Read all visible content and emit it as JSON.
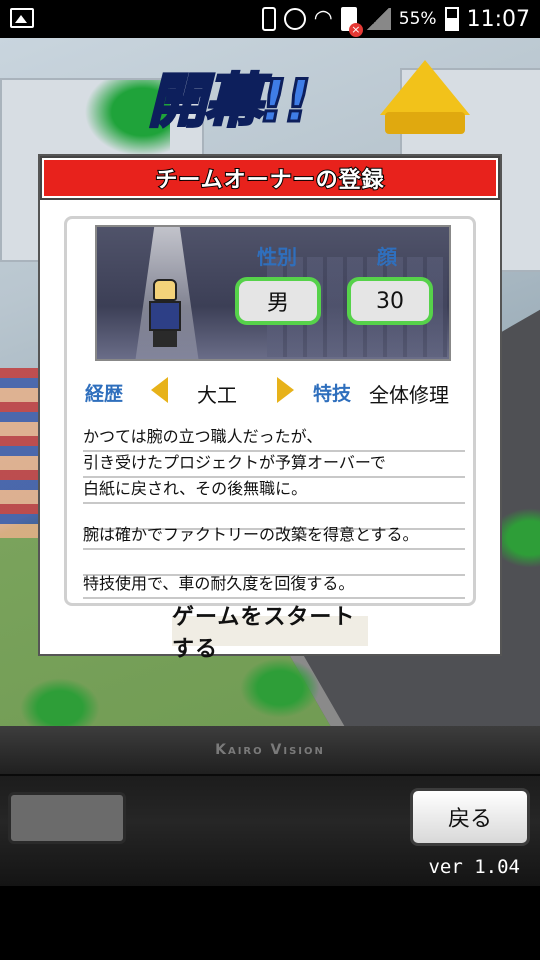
{
  "status_bar": {
    "battery_percent": "55%",
    "time": "11:07"
  },
  "title_logo": "開幕!!",
  "dialog": {
    "title": "チームオーナーの登録",
    "gender_label": "性別",
    "gender_value": "男",
    "face_label": "顔",
    "face_value": "30",
    "career_label": "経歴",
    "career_value": "大工",
    "skill_label": "特技",
    "skill_value": "全体修理",
    "description_lines": [
      "かつては腕の立つ職人だったが、",
      "引き受けたプロジェクトが予算オーバーで",
      "白紙に戻され、その後無職に。",
      "",
      "腕は確かでファクトリーの改築を得意とする。",
      "",
      "特技使用で、車の耐久度を回復する。"
    ],
    "start_button": "ゲームをスタートする"
  },
  "bottom_bar": {
    "brand": "Kairo Vision",
    "back_button": "戻る",
    "version": "ver 1.04"
  },
  "colors": {
    "header_red": "#e8221c",
    "label_blue": "#2f6fbd",
    "pill_green": "#56d24a",
    "arrow_gold": "#e7b21a"
  }
}
